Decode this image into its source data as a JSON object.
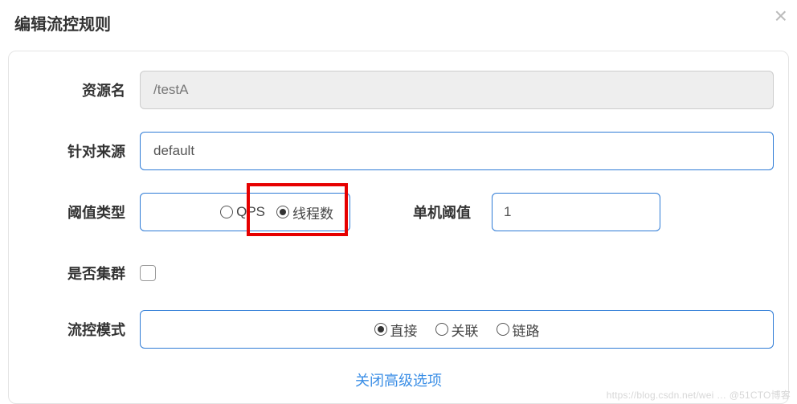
{
  "title": "编辑流控规则",
  "labels": {
    "resource": "资源名",
    "limitApp": "针对来源",
    "thresholdType": "阈值类型",
    "singleThreshold": "单机阈值",
    "cluster": "是否集群",
    "mode": "流控模式"
  },
  "values": {
    "resource": "/testA",
    "limitApp": "default",
    "thresholdType": "thread",
    "singleThreshold": "1",
    "cluster": false,
    "mode": "direct"
  },
  "options": {
    "thresholdType": {
      "qps": "QPS",
      "thread": "线程数"
    },
    "mode": {
      "direct": "直接",
      "relate": "关联",
      "chain": "链路"
    }
  },
  "link_close_advanced": "关闭高级选项",
  "watermark": "https://blog.csdn.net/wei … @51CTO博客"
}
